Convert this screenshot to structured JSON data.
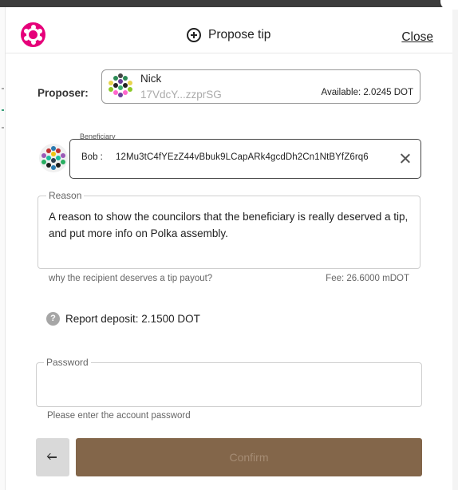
{
  "header": {
    "title": "Propose tip",
    "close_label": "Close",
    "brand_color": "#e6007a"
  },
  "proposer": {
    "label": "Proposer:",
    "name": "Nick",
    "address": "17VdcY...zzprSG",
    "available": "Available: 2.0245 DOT"
  },
  "beneficiary": {
    "label": "Beneficiary",
    "name": "Bob :",
    "address": "12Mu3tC4fYEzZ44vBbuk9LCapARk4gcdDh2Cn1NtBYfZ6rq6"
  },
  "reason": {
    "label": "Reason",
    "text": "A reason to show the councilors that the beneficiary is really deserved a tip, and put more info on Polka assembly.",
    "hint": "why the recipient deserves a tip payout?",
    "fee": "Fee: 26.6000 mDOT"
  },
  "deposit": {
    "icon": "?",
    "text": "Report deposit: 2.1500 DOT"
  },
  "password": {
    "label": "Password",
    "value": "",
    "hint": "Please enter the account password"
  },
  "actions": {
    "back_icon": "arrow-left-icon",
    "confirm_label": "Confirm",
    "confirm_color": "#83664a"
  }
}
